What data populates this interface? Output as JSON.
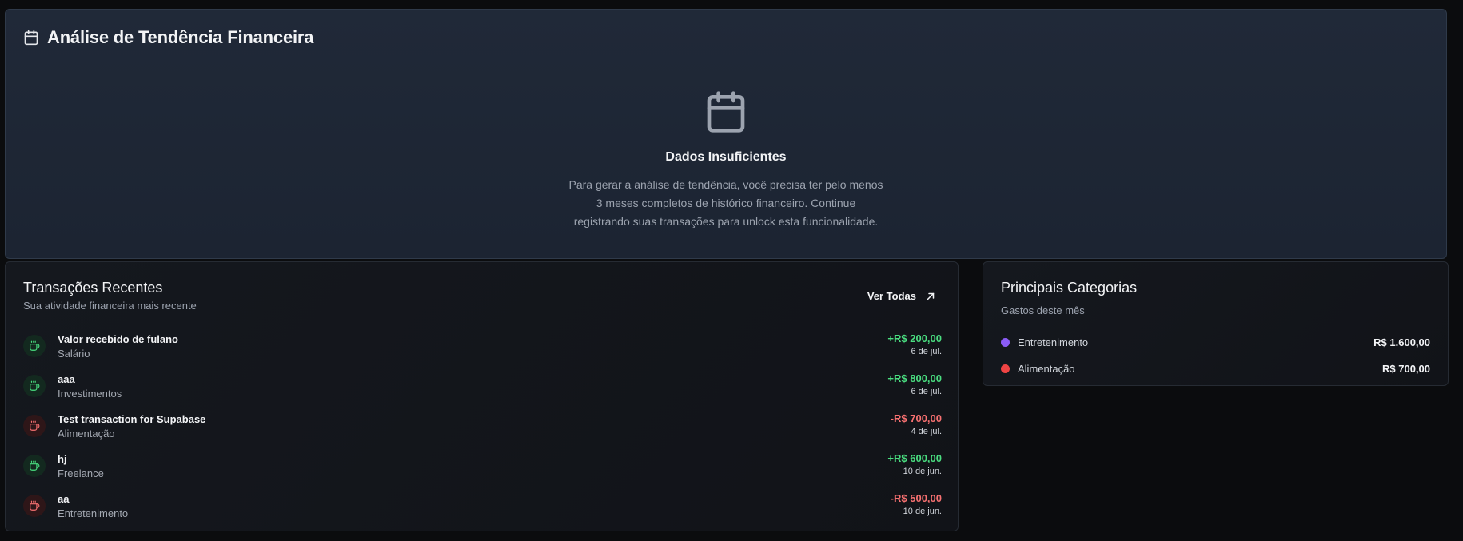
{
  "trend": {
    "title": "Análise de Tendência Financeira",
    "empty_title": "Dados Insuficientes",
    "empty_desc_lines": [
      "Para gerar a análise de tendência, você precisa ter pelo menos",
      "3 meses completos de histórico financeiro. Continue",
      "registrando suas transações para unlock esta funcionalidade."
    ]
  },
  "transactions": {
    "title": "Transações Recentes",
    "subtitle": "Sua atividade financeira mais recente",
    "see_all_label": "Ver Todas",
    "items": [
      {
        "name": "Valor recebido de fulano",
        "category": "Salário",
        "amount": "+R$ 200,00",
        "date": "6 de jul.",
        "type": "income"
      },
      {
        "name": "aaa",
        "category": "Investimentos",
        "amount": "+R$ 800,00",
        "date": "6 de jul.",
        "type": "income"
      },
      {
        "name": "Test transaction for Supabase",
        "category": "Alimentação",
        "amount": "-R$ 700,00",
        "date": "4 de jul.",
        "type": "expense"
      },
      {
        "name": "hj",
        "category": "Freelance",
        "amount": "+R$ 600,00",
        "date": "10 de jun.",
        "type": "income"
      },
      {
        "name": "aa",
        "category": "Entretenimento",
        "amount": "-R$ 500,00",
        "date": "10 de jun.",
        "type": "expense"
      }
    ]
  },
  "categories": {
    "title": "Principais Categorias",
    "subtitle": "Gastos deste mês",
    "items": [
      {
        "name": "Entretenimento",
        "value": "R$ 1.600,00",
        "color": "#8b5cf6"
      },
      {
        "name": "Alimentação",
        "value": "R$ 700,00",
        "color": "#ef4444"
      }
    ]
  },
  "colors": {
    "income": "#4ade80",
    "expense": "#f87171"
  },
  "icons": {
    "header": "calendar-icon",
    "empty": "calendar-icon",
    "transaction": "coffee-icon",
    "see_all": "arrow-up-right-icon"
  }
}
